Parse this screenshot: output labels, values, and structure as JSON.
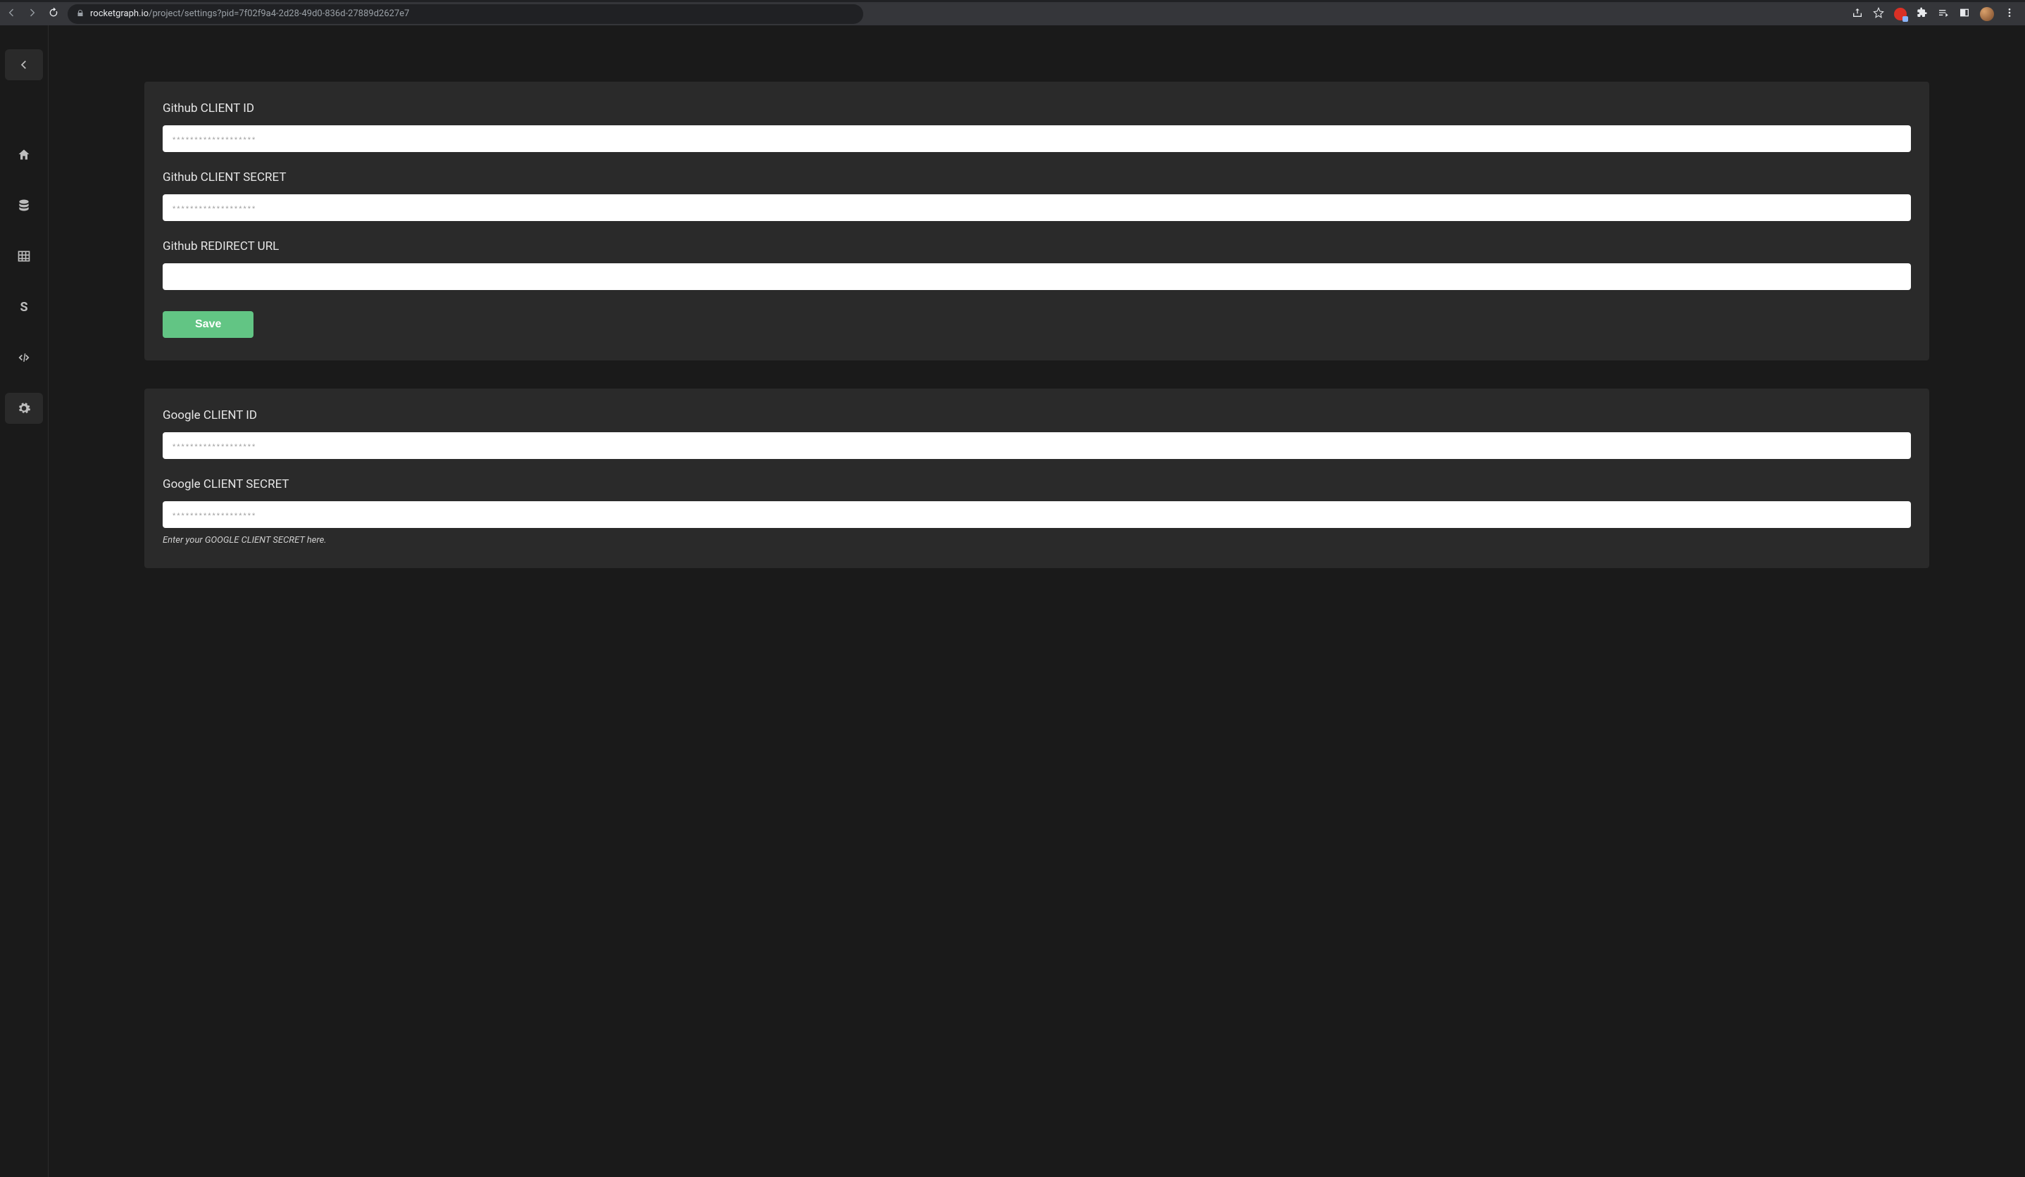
{
  "browser": {
    "url_host": "rocketgraph.io",
    "url_path": "/project/settings?pid=7f02f9a4-2d28-49d0-836d-27889d2627e7"
  },
  "sidebar": {
    "items": [
      {
        "id": "back",
        "label": "Back"
      },
      {
        "id": "home",
        "label": "Home"
      },
      {
        "id": "database",
        "label": "Database"
      },
      {
        "id": "table",
        "label": "Table"
      },
      {
        "id": "s",
        "label": "S"
      },
      {
        "id": "code",
        "label": "Code"
      },
      {
        "id": "settings",
        "label": "Settings"
      }
    ]
  },
  "forms": {
    "github": {
      "client_id_label": "Github CLIENT ID",
      "client_id_placeholder": "*******************",
      "client_id_value": "",
      "client_secret_label": "Github CLIENT SECRET",
      "client_secret_placeholder": "*******************",
      "client_secret_value": "",
      "redirect_label": "Github REDIRECT URL",
      "redirect_value": "",
      "save_label": "Save"
    },
    "google": {
      "client_id_label": "Google CLIENT ID",
      "client_id_placeholder": "*******************",
      "client_id_value": "",
      "client_secret_label": "Google CLIENT SECRET",
      "client_secret_placeholder": "*******************",
      "client_secret_value": "",
      "client_secret_help": "Enter your GOOGLE CLIENT SECRET here."
    }
  }
}
